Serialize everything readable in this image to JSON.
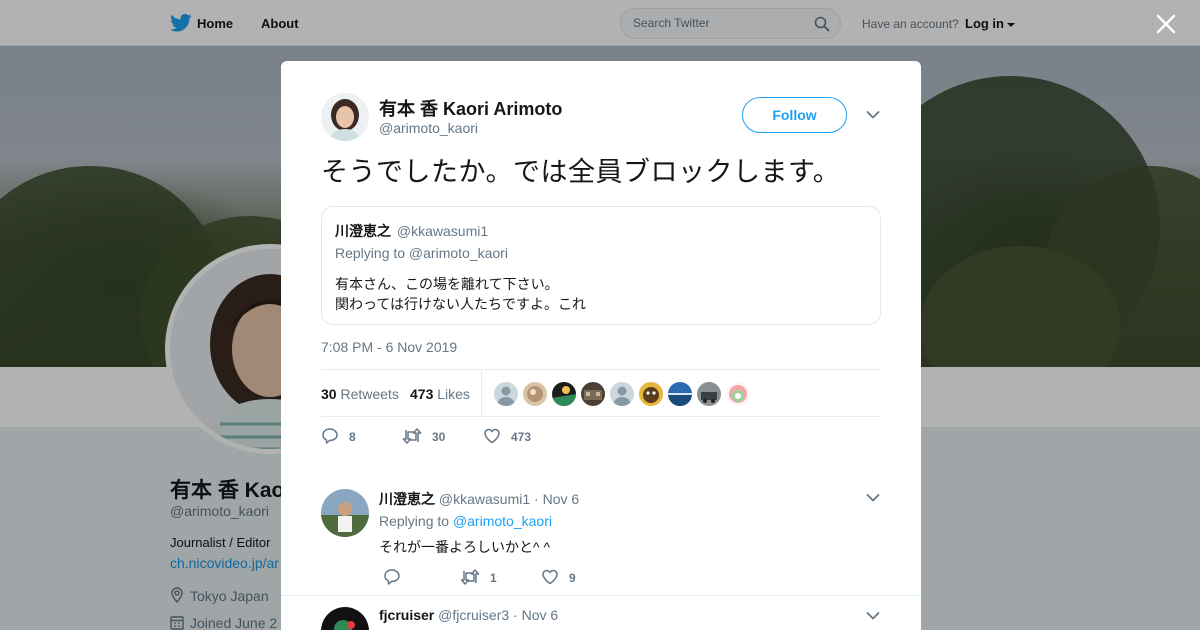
{
  "colors": {
    "accent": "#1da1f2",
    "text": "#14171a",
    "muted": "#657786",
    "border": "#e6ecf0"
  },
  "nav": {
    "logo_icon": "twitter-bird-icon",
    "home_label": "Home",
    "about_label": "About",
    "search_placeholder": "Search Twitter",
    "have_account": "Have an account?",
    "login_label": "Log in"
  },
  "profile": {
    "name": "有本 香 Kaori Arimoto",
    "handle": "@arimoto_kaori",
    "bio": "Journalist / Editor",
    "link": "ch.nicovideo.jp/ar",
    "location": "Tokyo Japan",
    "joined": "Joined June 2"
  },
  "tweet": {
    "name": "有本 香 Kaori Arimoto",
    "handle": "@arimoto_kaori",
    "follow_label": "Follow",
    "text": "そうでしたか。では全員ブロックします。",
    "quoted": {
      "name": "川澄恵之",
      "handle": "@kkawasumi1",
      "replying": "Replying to @arimoto_kaori",
      "line1": "有本さん、この場を離れて下さい。",
      "line2": "関わっては行けない人たちですよ。これ"
    },
    "timestamp": "7:08 PM - 6 Nov 2019",
    "retweets_count": "30",
    "retweets_label": "Retweets",
    "likes_count": "473",
    "likes_label": "Likes",
    "actions": {
      "replies": "8",
      "retweets": "30",
      "likes": "473"
    }
  },
  "replies": [
    {
      "name": "川澄恵之",
      "handle": "@kkawasumi1",
      "date": "· Nov 6",
      "replying_prefix": "Replying to",
      "replying_to": "@arimoto_kaori",
      "text": "それが一番よろしいかと^ ^",
      "actions": {
        "replies": "",
        "retweets": "1",
        "likes": "9"
      }
    },
    {
      "name": "fjcruiser",
      "handle": "@fjcruiser3",
      "date": "· Nov 6"
    }
  ]
}
